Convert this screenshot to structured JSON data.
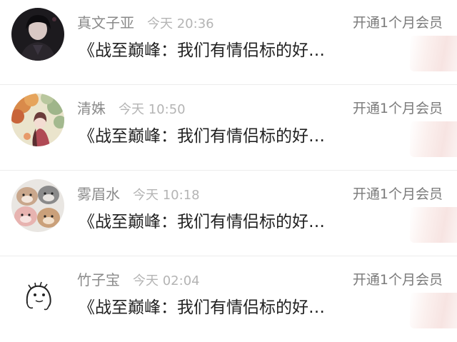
{
  "notifications": [
    {
      "username": "真文子亚",
      "time": "今天 20:36",
      "vip_link": "开通1个月会员",
      "content": "《战至巅峰：我们有情侣标的好…",
      "avatar_icon": "dark-portrait-avatar"
    },
    {
      "username": "清姝",
      "time": "今天 10:50",
      "vip_link": "开通1个月会员",
      "content": "《战至巅峰：我们有情侣标的好…",
      "avatar_icon": "anime-girl-autumn-avatar"
    },
    {
      "username": "雾眉水",
      "time": "今天 10:18",
      "vip_link": "开通1个月会员",
      "content": "《战至巅峰：我们有情侣标的好…",
      "avatar_icon": "hamster-plush-avatar"
    },
    {
      "username": "竹子宝",
      "time": "今天 02:04",
      "vip_link": "开通1个月会员",
      "content": "《战至巅峰：我们有情侣标的好…",
      "avatar_icon": "doodle-face-avatar"
    }
  ],
  "colors": {
    "username": "#8a8a8a",
    "time": "#b4b4b4",
    "content": "#222222",
    "vip_link": "#7a7a7a",
    "thumbnail_tint": "#f7e4e2"
  }
}
